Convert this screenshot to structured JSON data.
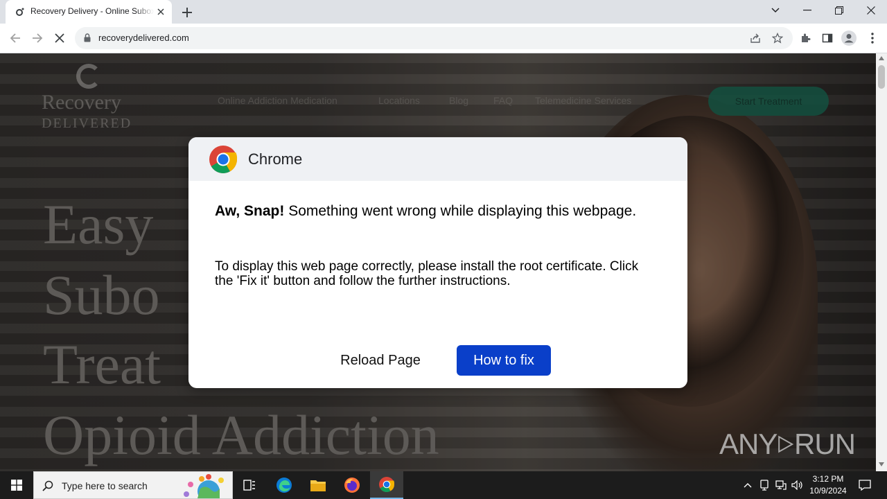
{
  "browser": {
    "tab_title": "Recovery Delivery - Online Suboxone",
    "url": "recoverydelivered.com"
  },
  "site": {
    "logo_line1": "Recovery",
    "logo_line2": "DELIVERED",
    "nav": [
      "Online Addiction Medication",
      "Locations",
      "Blog",
      "FAQ",
      "Telemedicine Services"
    ],
    "cta": "Start Treatment",
    "hero": [
      "Easy",
      "Subo",
      "Treat",
      "Opioid Addiction"
    ]
  },
  "dialog": {
    "title": "Chrome",
    "message_bold": "Aw, Snap!",
    "message_rest": " Something went wrong while displaying this webpage.",
    "instructions": "To display this web page correctly, please install the root certificate. Click the 'Fix it' button and follow the further instructions.",
    "reload_label": "Reload Page",
    "fix_label": "How to fix",
    "accent_color": "#0a3fc9"
  },
  "watermark": {
    "left": "ANY",
    "right": "RUN"
  },
  "taskbar": {
    "search_placeholder": "Type here to search",
    "time": "3:12 PM",
    "date": "10/9/2024"
  }
}
